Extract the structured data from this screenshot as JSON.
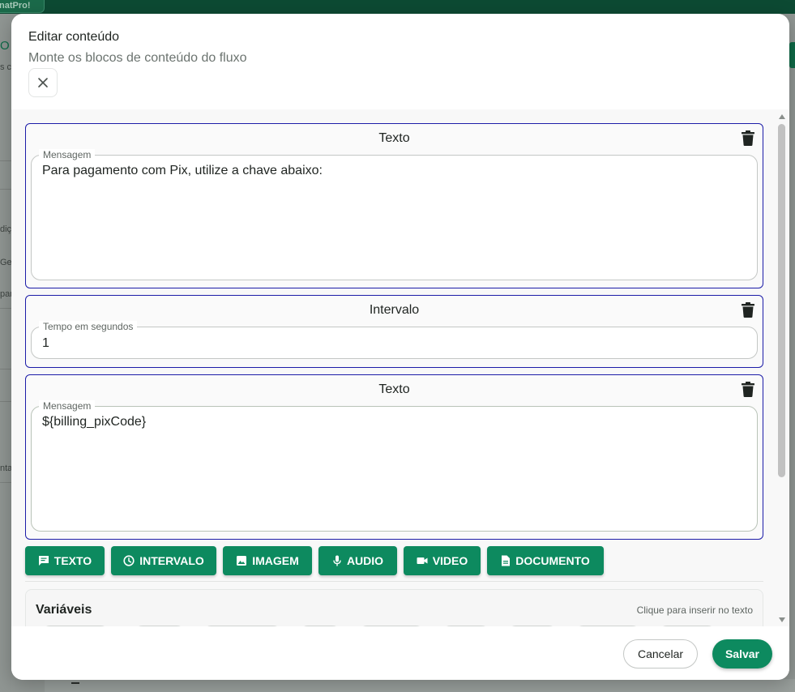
{
  "background": {
    "app_badge": "natPro!",
    "side_fragments": [
      "O",
      "s co",
      "diçã",
      "Gel",
      "pan",
      "nta"
    ]
  },
  "modal": {
    "title": "Editar conteúdo",
    "subtitle": "Monte os blocos de conteúdo do fluxo",
    "close_icon": "close-icon"
  },
  "blocks": [
    {
      "title": "Texto",
      "field_label": "Mensagem",
      "value": "Para pagamento com Pix, utilize a chave abaixo:"
    },
    {
      "title": "Intervalo",
      "field_label": "Tempo em segundos",
      "value": "1"
    },
    {
      "title": "Texto",
      "field_label": "Mensagem",
      "value": "${billing_pixCode}"
    }
  ],
  "add_buttons": {
    "texto": "TEXTO",
    "intervalo": "INTERVALO",
    "imagem": "IMAGEM",
    "audio": "AUDIO",
    "video": "VIDEO",
    "documento": "DOCUMENTO"
  },
  "variables": {
    "title": "Variáveis",
    "hint": "Clique para inserir no texto"
  },
  "footer": {
    "cancel": "Cancelar",
    "save": "Salvar"
  },
  "colors": {
    "accent": "#0d8a5f",
    "block_border": "#1c1ca8",
    "topbar": "#0d4a33"
  }
}
